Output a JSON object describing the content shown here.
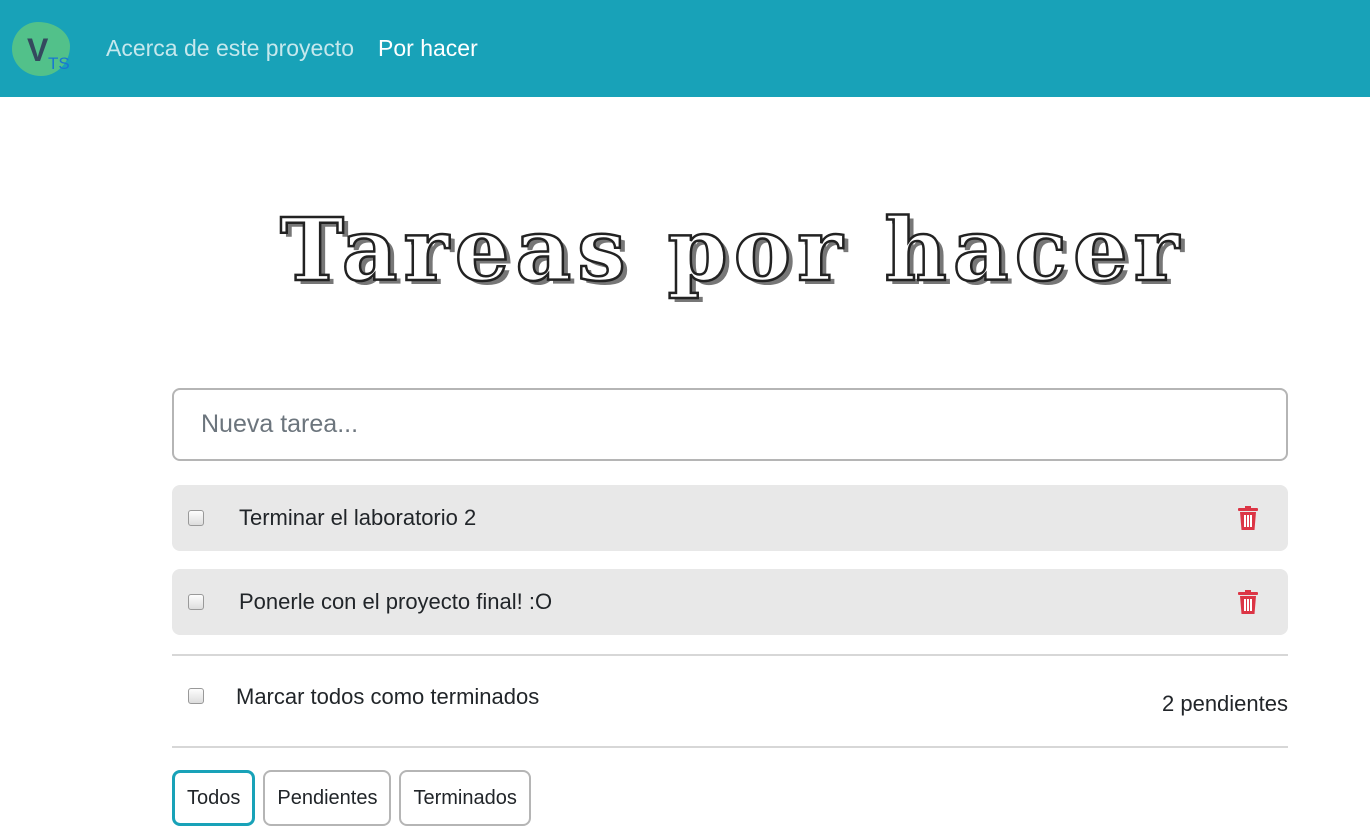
{
  "nav": {
    "logo_text": "V",
    "logo_sub": "TS",
    "links": [
      {
        "label": "Acerca de este proyecto"
      },
      {
        "label": "Por hacer"
      }
    ]
  },
  "title": "Tareas por hacer",
  "new_task": {
    "placeholder": "Nueva tarea...",
    "value": ""
  },
  "todos": [
    {
      "text": "Terminar el laboratorio 2",
      "done": false
    },
    {
      "text": "Ponerle con el proyecto final! :O",
      "done": false
    }
  ],
  "footer": {
    "mark_all_label": "Marcar todos como terminados",
    "pending_count": "2 pendientes"
  },
  "filters": [
    {
      "label": "Todos",
      "active": true
    },
    {
      "label": "Pendientes"
    },
    {
      "label": "Terminados"
    }
  ],
  "colors": {
    "nav": "#18a2b8",
    "delete": "#dc3545"
  }
}
